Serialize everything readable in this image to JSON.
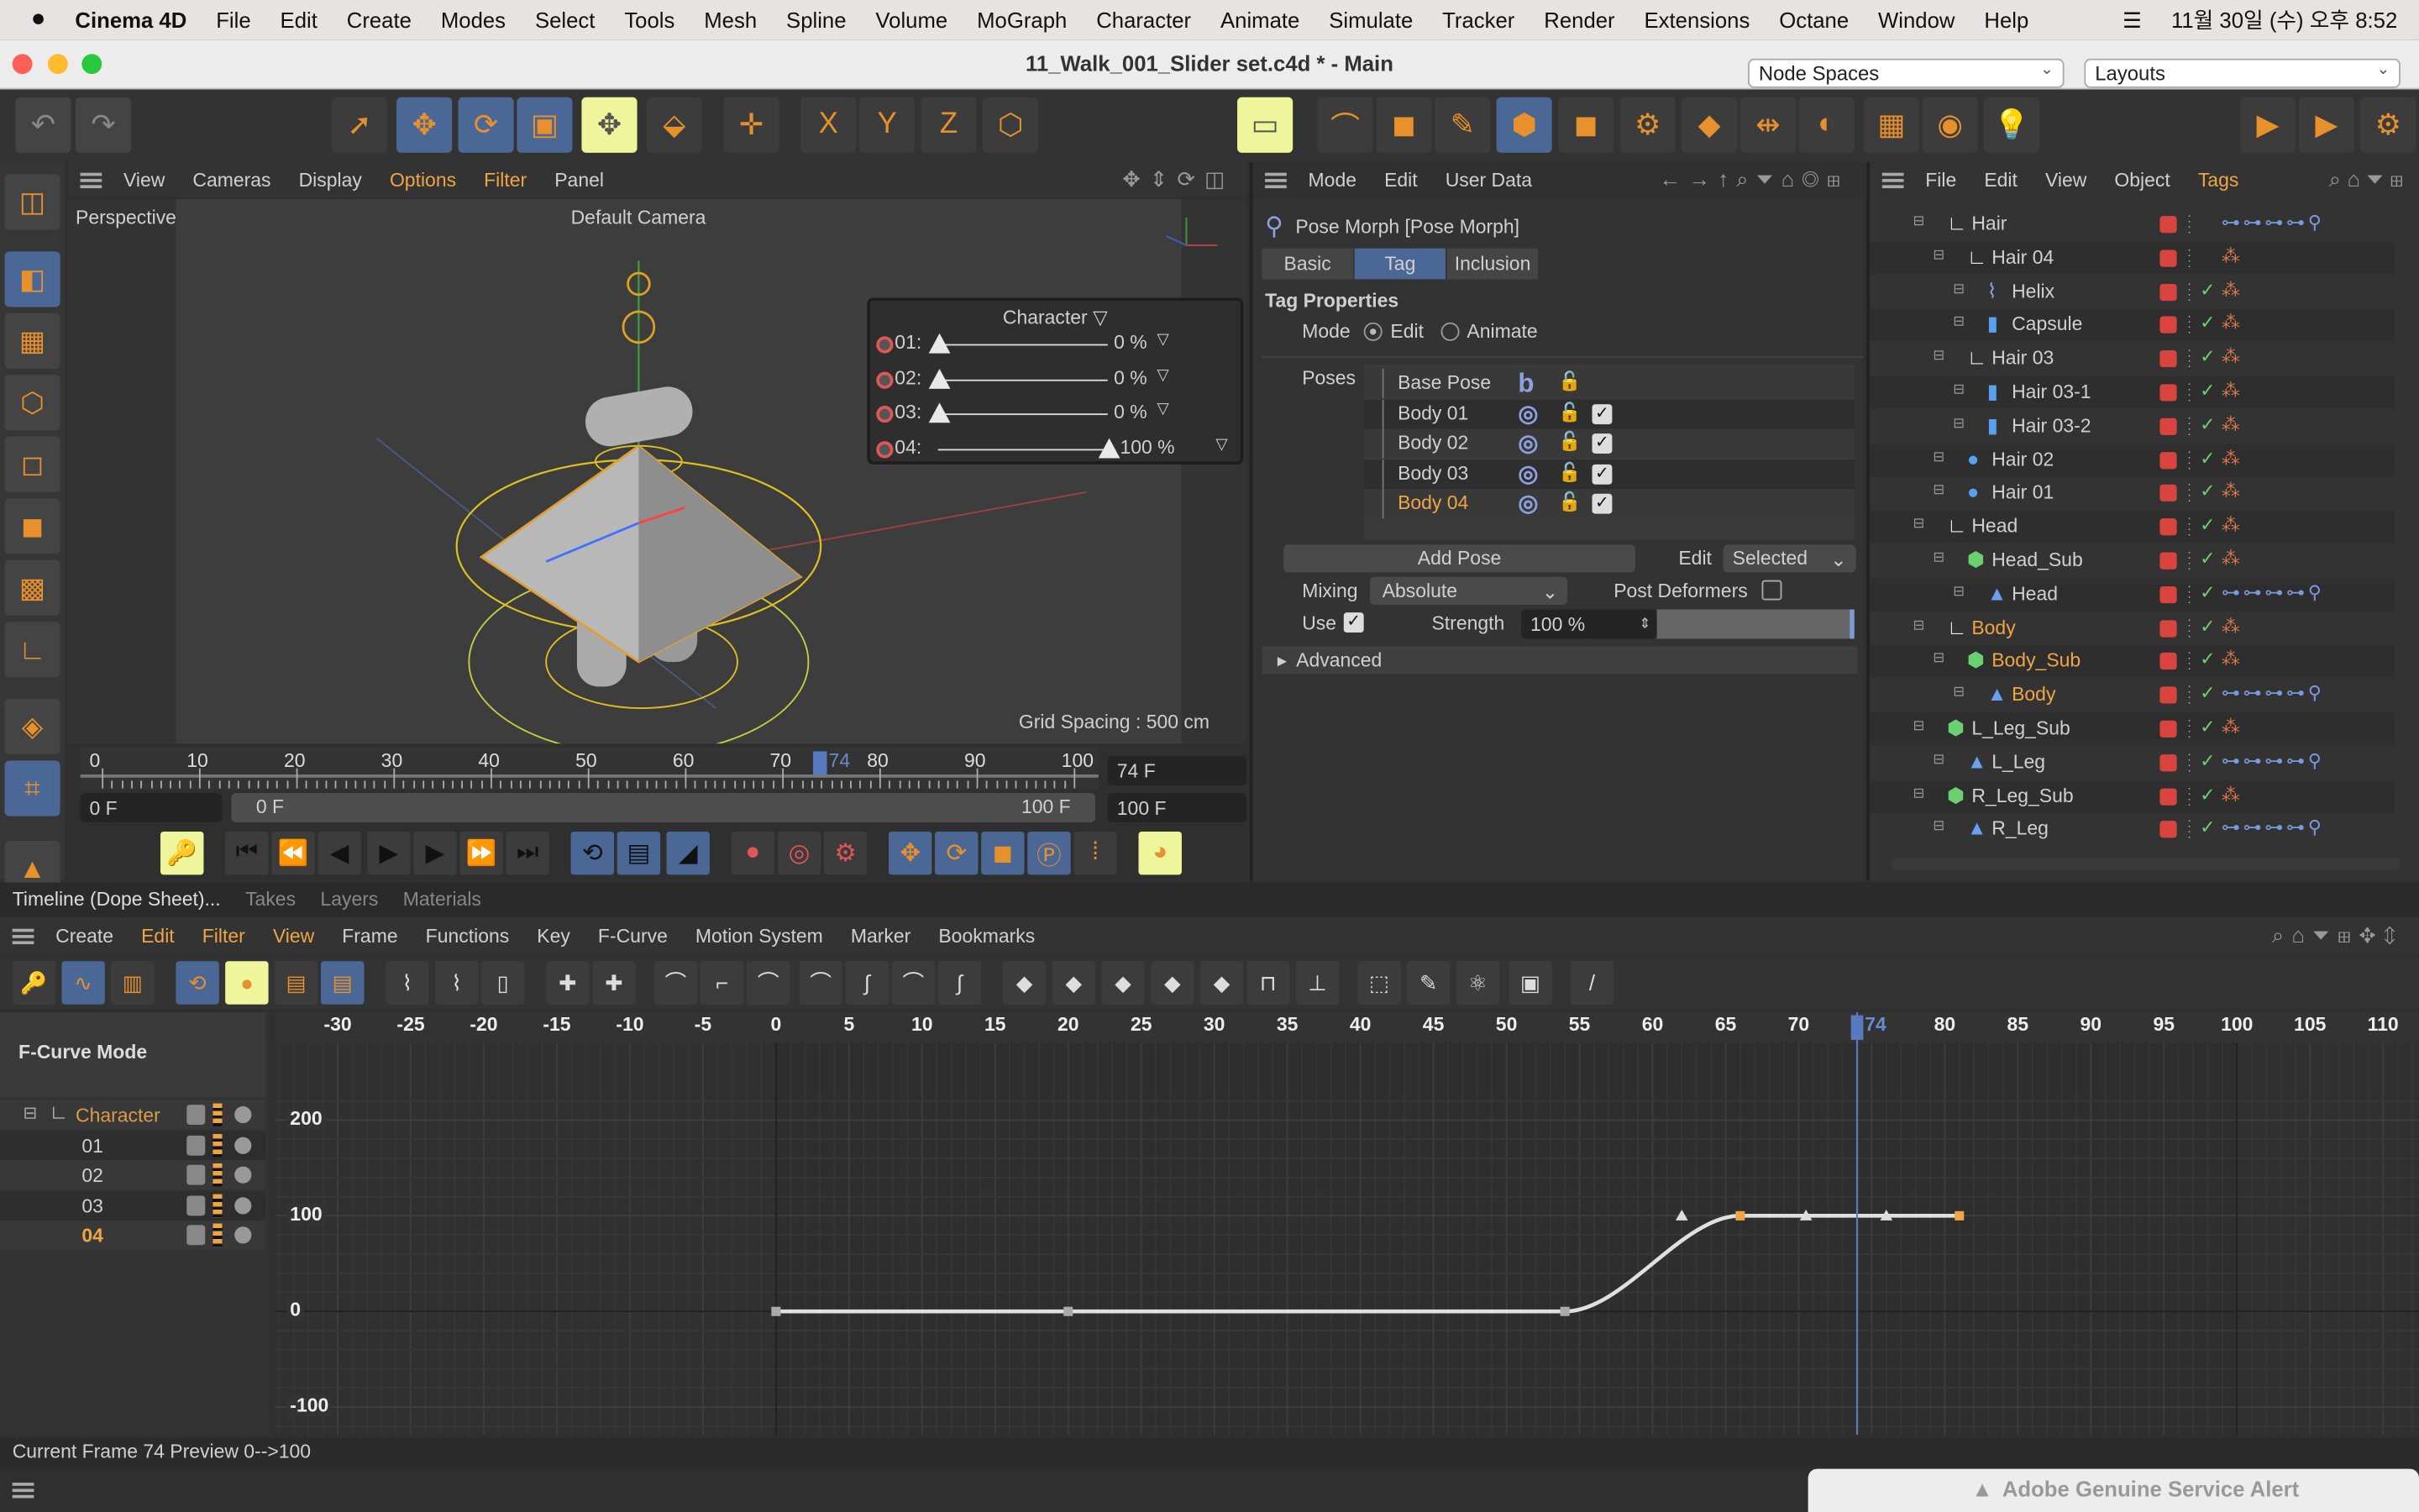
{
  "menubar": {
    "app": "Cinema 4D",
    "items": [
      "File",
      "Edit",
      "Create",
      "Modes",
      "Select",
      "Tools",
      "Mesh",
      "Spline",
      "Volume",
      "MoGraph",
      "Character",
      "Animate",
      "Simulate",
      "Tracker",
      "Render",
      "Extensions",
      "Octane",
      "Window",
      "Help"
    ],
    "clock": "11월 30일 (수) 오후 8:52"
  },
  "window": {
    "title": "11_Walk_001_Slider set.c4d * - Main",
    "node_spaces": "Node Spaces",
    "layouts": "Layouts"
  },
  "toolbar": {
    "icons": [
      "undo-icon",
      "redo-icon",
      "live-selection-icon",
      "move-icon",
      "rotate-icon",
      "scale-icon",
      "transform-icon",
      "place-icon",
      "axis-icon",
      "lock-x-icon",
      "lock-y-icon",
      "lock-z-icon",
      "coordinate-system-icon",
      "asset-browser-icon",
      "spline-pen-icon",
      "cube-icon",
      "sketch-icon",
      "subdivision-icon",
      "extrude-icon",
      "cloner-icon",
      "mograph-icon",
      "symmetry-icon",
      "deformer-icon",
      "floor-icon",
      "camera-icon",
      "light-icon",
      "render-view-icon",
      "render-picture-viewer-icon",
      "render-settings-icon"
    ]
  },
  "viewport": {
    "menu": [
      "View",
      "Cameras",
      "Display",
      "Options",
      "Filter",
      "Panel"
    ],
    "active_menu": [
      "Options",
      "Filter"
    ],
    "label": "Perspective",
    "camera": "Default Camera",
    "grid_spacing": "Grid Spacing : 500 cm",
    "slider_panel": {
      "title": "Character",
      "sliders": [
        {
          "label": "01:",
          "value": 0,
          "text": "0 %"
        },
        {
          "label": "02:",
          "value": 0,
          "text": "0 %"
        },
        {
          "label": "03:",
          "value": 0,
          "text": "0 %"
        },
        {
          "label": "04:",
          "value": 100,
          "text": "100 %"
        }
      ]
    }
  },
  "timeline": {
    "ticks": [
      "0",
      "10",
      "20",
      "30",
      "40",
      "50",
      "60",
      "70",
      "80",
      "90",
      "100"
    ],
    "current": "74",
    "current_field": "74 F",
    "start": "0 F",
    "range_start": "0 F",
    "range_end": "100 F",
    "end": "100 F"
  },
  "attributes": {
    "menu": [
      "Mode",
      "Edit",
      "User Data"
    ],
    "object": "Pose Morph [Pose Morph]",
    "tabs": [
      "Basic",
      "Tag",
      "Inclusion"
    ],
    "active_tab": "Tag",
    "section": "Tag Properties",
    "mode_label": "Mode",
    "mode_options": [
      "Edit",
      "Animate"
    ],
    "mode_selected": "Edit",
    "poses_label": "Poses",
    "poses": [
      {
        "name": "Base Pose",
        "checked": null
      },
      {
        "name": "Body 01",
        "checked": true
      },
      {
        "name": "Body 02",
        "checked": true
      },
      {
        "name": "Body 03",
        "checked": true
      },
      {
        "name": "Body 04",
        "checked": true
      }
    ],
    "selected_pose": "Body 04",
    "add_pose": "Add Pose",
    "edit_label": "Edit",
    "edit_value": "Selected",
    "mixing_label": "Mixing",
    "mixing_value": "Absolute",
    "post_deformers": "Post Deformers",
    "post_deformers_checked": false,
    "use_label": "Use",
    "use_checked": true,
    "strength_label": "Strength",
    "strength_value": "100 %",
    "strength": 100,
    "advanced": "Advanced"
  },
  "objects": {
    "menu": [
      "File",
      "Edit",
      "View",
      "Object",
      "Tags"
    ],
    "active_menu": "Tags",
    "rows": [
      {
        "name": "Hair",
        "depth": 1,
        "icon": "null-icon"
      },
      {
        "name": "Hair 04",
        "depth": 2,
        "icon": "null-icon"
      },
      {
        "name": "Helix",
        "depth": 3,
        "icon": "spline-icon"
      },
      {
        "name": "Capsule",
        "depth": 3,
        "icon": "capsule-icon"
      },
      {
        "name": "Hair 03",
        "depth": 2,
        "icon": "null-icon"
      },
      {
        "name": "Hair 03-1",
        "depth": 3,
        "icon": "capsule-icon"
      },
      {
        "name": "Hair 03-2",
        "depth": 3,
        "icon": "capsule-icon"
      },
      {
        "name": "Hair 02",
        "depth": 2,
        "icon": "sphere-icon"
      },
      {
        "name": "Hair 01",
        "depth": 2,
        "icon": "sphere-icon"
      },
      {
        "name": "Head",
        "depth": 1,
        "icon": "null-icon"
      },
      {
        "name": "Head_Sub",
        "depth": 2,
        "icon": "subdivision-icon"
      },
      {
        "name": "Head",
        "depth": 3,
        "icon": "polygon-icon"
      },
      {
        "name": "Body",
        "depth": 1,
        "icon": "null-icon",
        "highlight": true
      },
      {
        "name": "Body_Sub",
        "depth": 2,
        "icon": "subdivision-icon",
        "highlight": true
      },
      {
        "name": "Body",
        "depth": 3,
        "icon": "polygon-icon",
        "highlight": true
      },
      {
        "name": "L_Leg_Sub",
        "depth": 1,
        "icon": "subdivision-icon"
      },
      {
        "name": "L_Leg",
        "depth": 2,
        "icon": "polygon-icon"
      },
      {
        "name": "R_Leg_Sub",
        "depth": 1,
        "icon": "subdivision-icon"
      },
      {
        "name": "R_Leg",
        "depth": 2,
        "icon": "polygon-icon"
      }
    ]
  },
  "bottom": {
    "tabs": [
      "Timeline (Dope Sheet)...",
      "Takes",
      "Layers",
      "Materials"
    ],
    "menu": [
      "Create",
      "Edit",
      "Filter",
      "View",
      "Frame",
      "Functions",
      "Key",
      "F-Curve",
      "Motion System",
      "Marker",
      "Bookmarks"
    ],
    "active_menu": [
      "Edit",
      "Filter",
      "View"
    ],
    "mode": "F-Curve Mode",
    "tracks": [
      {
        "name": "Character",
        "root": true
      },
      {
        "name": "01"
      },
      {
        "name": "02"
      },
      {
        "name": "03"
      },
      {
        "name": "04",
        "selected": true
      }
    ]
  },
  "fcurve": {
    "x_ticks": [
      -30,
      -25,
      -20,
      -15,
      -10,
      -5,
      0,
      5,
      10,
      15,
      20,
      25,
      30,
      35,
      40,
      45,
      50,
      55,
      60,
      65,
      70,
      75,
      80,
      85,
      90,
      95,
      100,
      105,
      110
    ],
    "y_ticks": [
      200,
      100,
      0,
      -100
    ],
    "xlim": [
      -33,
      111
    ],
    "ylim": [
      -110,
      230
    ],
    "current_frame": 74,
    "current_label": "74",
    "keys": [
      [
        0,
        0
      ],
      [
        20,
        0
      ],
      [
        54,
        0
      ],
      [
        66,
        100
      ],
      [
        81,
        100
      ]
    ],
    "curve_color": "#e0e0e0",
    "playhead_color": "#5a7ac0"
  },
  "status": {
    "text": "Current Frame  74  Preview  0-->100",
    "alert": "Adobe Genuine Service Alert"
  },
  "colors": {
    "accent": "#f0a545",
    "blue": "#4a6795",
    "highlight": "#eef59a"
  }
}
